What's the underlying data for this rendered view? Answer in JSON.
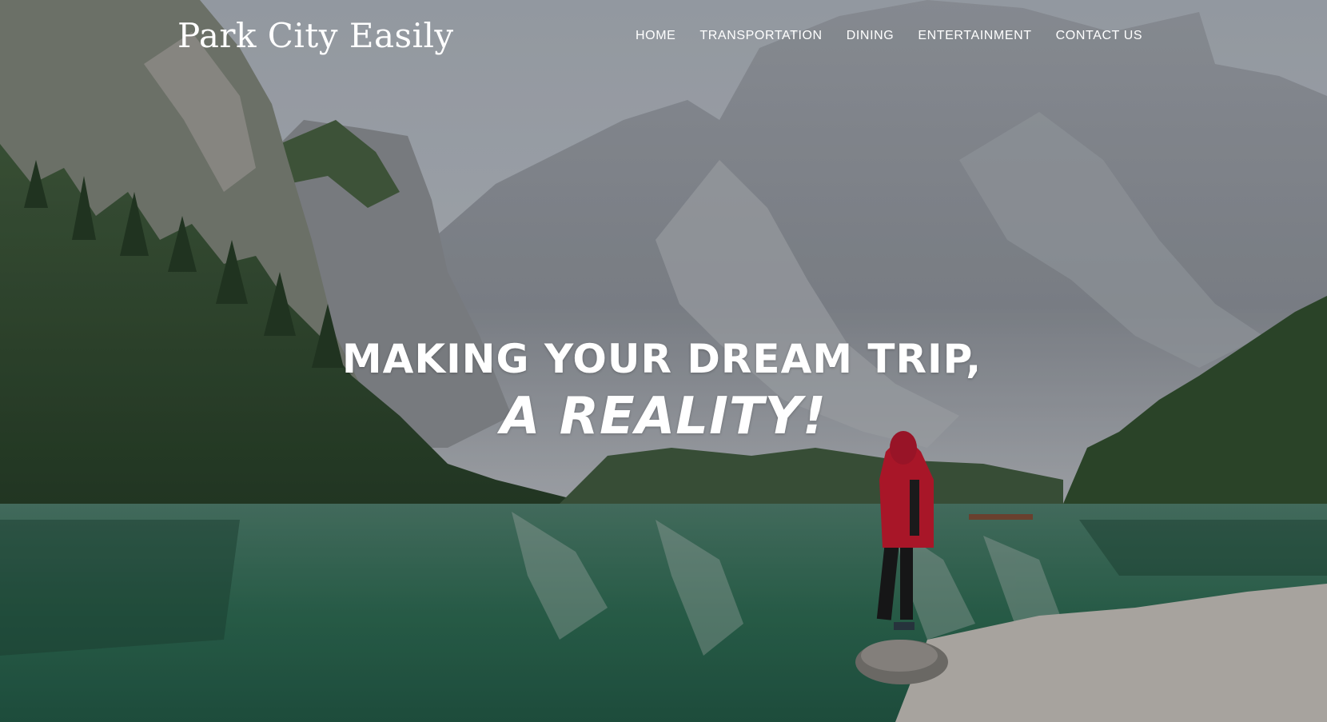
{
  "site": {
    "brand": "Park City Easily"
  },
  "nav": {
    "items": [
      {
        "label": "HOME"
      },
      {
        "label": "TRANSPORTATION"
      },
      {
        "label": "DINING"
      },
      {
        "label": "ENTERTAINMENT"
      },
      {
        "label": "CONTACT US"
      }
    ]
  },
  "hero": {
    "line1": "MAKING YOUR DREAM TRIP,",
    "line2": "A REALITY!"
  },
  "colors": {
    "text": "#ffffff",
    "jacket": "#c8172b",
    "water": "#2f6e55",
    "forest": "#2d4a2c"
  }
}
